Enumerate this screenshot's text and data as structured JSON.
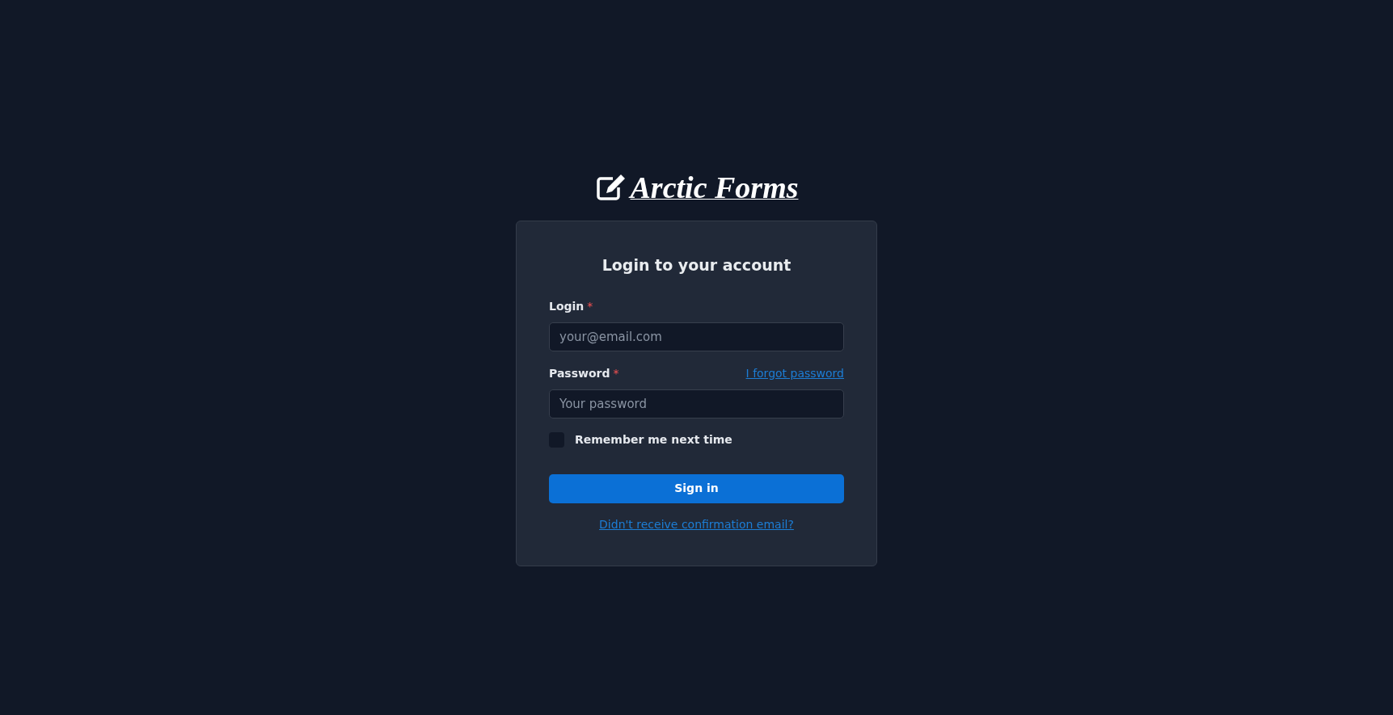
{
  "logo": {
    "text": "Arctic Forms"
  },
  "card": {
    "title": "Login to your account",
    "fields": [
      {
        "label": "Login",
        "required_mark": "*",
        "placeholder": "your@email.com"
      },
      {
        "label": "Password",
        "required_mark": "*",
        "placeholder": "Your password",
        "link": "I forgot password"
      }
    ],
    "remember": {
      "label": "Remember me next time",
      "checked": false
    },
    "submit": "Sign in",
    "footer_link": "Didn't receive confirmation email?"
  }
}
